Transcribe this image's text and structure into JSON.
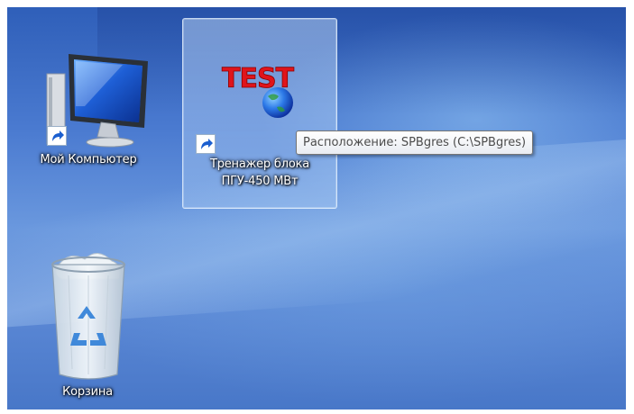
{
  "desktop": {
    "icons": [
      {
        "label": "Мой Компьютер",
        "icon": "computer-icon",
        "shortcut": true,
        "selected": false
      },
      {
        "label": "Тренажер блока\nПГУ-450 МВт",
        "icon": "test-app-icon",
        "logo_text": "TEST",
        "shortcut": true,
        "selected": true
      },
      {
        "label": "Корзина",
        "icon": "recycle-bin-icon",
        "shortcut": false,
        "selected": false
      }
    ],
    "tooltip": "Расположение: SPBgres (C:\\SPBgres)"
  },
  "colors": {
    "tooltip_text": "#4c4c4c",
    "logo_red": "#e0141b",
    "globe_blue": "#1f5fd9"
  }
}
